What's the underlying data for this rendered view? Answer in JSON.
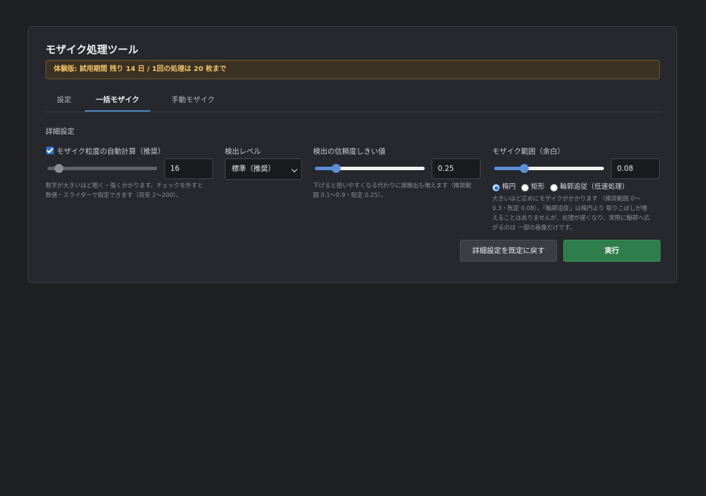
{
  "app": {
    "title": "モザイク処理ツール",
    "trial_notice": "体験版: 試用期間 残り 14 日 / 1回の処理は 20 枚まで"
  },
  "tabs": [
    {
      "label": "設定",
      "active": false
    },
    {
      "label": "一括モザイク",
      "active": true
    },
    {
      "label": "手動モザイク",
      "active": false
    }
  ],
  "details": {
    "section_label": "詳細設定",
    "granularity": {
      "checkbox_label": "モザイク粒度の自動計算（推奨）",
      "checked": true,
      "value": "16",
      "slider_fraction": 0.1,
      "help": [
        "数字が大きいほど粗く・強くかかります。チェックを外すと",
        "数値・スライダーで指定できます（目安 2〜200）。"
      ]
    },
    "detection_level": {
      "label": "検出レベル",
      "selected": "標準（推奨）"
    },
    "confidence": {
      "label": "検出の信頼度しきい値",
      "value": "0.25",
      "slider_fraction": 0.19,
      "help": [
        "下げると拾いやすくなる代わりに誤検出も増えます（推奨範",
        "囲 0.1〜0.9・既定 0.25）。"
      ]
    },
    "mosaic_range": {
      "label": "モザイク範囲（余白）",
      "value": "0.08",
      "slider_fraction": 0.27,
      "shape_options": [
        {
          "label": "楕円",
          "checked": true
        },
        {
          "label": "矩形",
          "checked": false
        },
        {
          "label": "輪郭追従（低速処理）",
          "checked": false
        }
      ],
      "help": [
        "大きいほど広めにモザイクがかかります （推奨範囲 0〜",
        "0.3・既定 0.08）。「輪郭追従」は楕円より 取りこぼしが増",
        "えることはありませんが、処理が遅くなり、実際に輪郭へ広",
        "がるのは 一部の画像だけです。"
      ]
    }
  },
  "buttons": {
    "reset": "詳細設定を既定に戻す",
    "run": "実行"
  },
  "colors": {
    "accent": "#5d8ed5",
    "primary_button": "#2f7d4b",
    "warning_text": "#f2c46a"
  }
}
